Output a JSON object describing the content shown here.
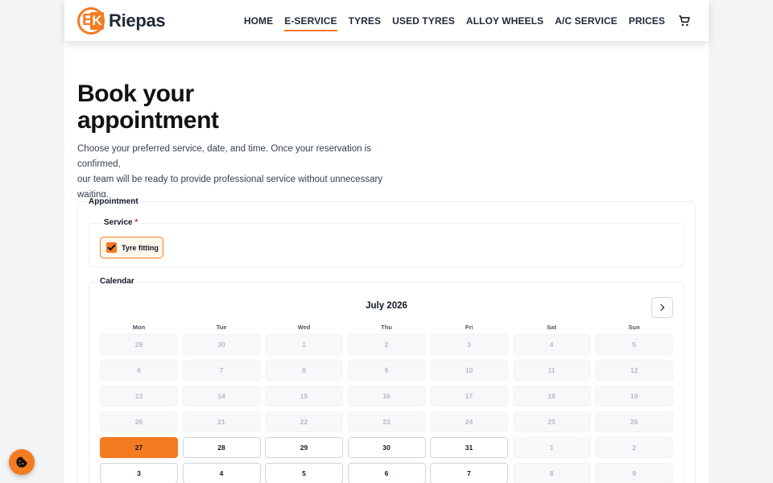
{
  "brand": {
    "name": "Riepas",
    "accent": "#f47b20",
    "logo_letters": "EK"
  },
  "nav": {
    "items": [
      {
        "label": "HOME",
        "active": false
      },
      {
        "label": "E-SERVICE",
        "active": true
      },
      {
        "label": "TYRES",
        "active": false
      },
      {
        "label": "USED TYRES",
        "active": false
      },
      {
        "label": "ALLOY WHEELS",
        "active": false
      },
      {
        "label": "A/C SERVICE",
        "active": false
      },
      {
        "label": "PRICES",
        "active": false
      }
    ],
    "cart_icon": "cart-icon"
  },
  "intro": {
    "title": "Book your appointment",
    "subtitle_line1": "Choose your preferred service, date, and time. Once your reservation is confirmed,",
    "subtitle_line2": "our team will be ready to provide professional service without unnecessary waiting."
  },
  "appointment": {
    "legend": "Appointment",
    "service": {
      "legend": "Service",
      "required_mark": "*",
      "option_label": "Tyre fitting",
      "checked": true
    },
    "calendar": {
      "legend": "Calendar",
      "month": "July 2026",
      "weekdays": [
        "Mon",
        "Tue",
        "Wed",
        "Thu",
        "Fri",
        "Sat",
        "Sun"
      ],
      "weeks": [
        [
          {
            "d": "29",
            "s": "disabled"
          },
          {
            "d": "30",
            "s": "disabled"
          },
          {
            "d": "1",
            "s": "disabled"
          },
          {
            "d": "2",
            "s": "disabled"
          },
          {
            "d": "3",
            "s": "disabled"
          },
          {
            "d": "4",
            "s": "disabled"
          },
          {
            "d": "5",
            "s": "disabled"
          }
        ],
        [
          {
            "d": "6",
            "s": "disabled"
          },
          {
            "d": "7",
            "s": "disabled"
          },
          {
            "d": "8",
            "s": "disabled"
          },
          {
            "d": "9",
            "s": "disabled"
          },
          {
            "d": "10",
            "s": "disabled"
          },
          {
            "d": "11",
            "s": "disabled"
          },
          {
            "d": "12",
            "s": "disabled"
          }
        ],
        [
          {
            "d": "13",
            "s": "disabled"
          },
          {
            "d": "14",
            "s": "disabled"
          },
          {
            "d": "15",
            "s": "disabled"
          },
          {
            "d": "16",
            "s": "disabled"
          },
          {
            "d": "17",
            "s": "disabled"
          },
          {
            "d": "18",
            "s": "disabled"
          },
          {
            "d": "19",
            "s": "disabled"
          }
        ],
        [
          {
            "d": "20",
            "s": "disabled"
          },
          {
            "d": "21",
            "s": "disabled"
          },
          {
            "d": "22",
            "s": "disabled"
          },
          {
            "d": "23",
            "s": "disabled"
          },
          {
            "d": "24",
            "s": "disabled"
          },
          {
            "d": "25",
            "s": "disabled"
          },
          {
            "d": "26",
            "s": "disabled"
          }
        ],
        [
          {
            "d": "27",
            "s": "selected"
          },
          {
            "d": "28",
            "s": "avail"
          },
          {
            "d": "29",
            "s": "avail"
          },
          {
            "d": "30",
            "s": "avail"
          },
          {
            "d": "31",
            "s": "avail"
          },
          {
            "d": "1",
            "s": "disabled"
          },
          {
            "d": "2",
            "s": "disabled"
          }
        ],
        [
          {
            "d": "3",
            "s": "avail"
          },
          {
            "d": "4",
            "s": "avail"
          },
          {
            "d": "5",
            "s": "avail"
          },
          {
            "d": "6",
            "s": "avail"
          },
          {
            "d": "7",
            "s": "avail"
          },
          {
            "d": "8",
            "s": "disabled"
          },
          {
            "d": "9",
            "s": "disabled"
          }
        ]
      ]
    }
  },
  "cookie_button": {
    "icon": "cookie-icon"
  }
}
